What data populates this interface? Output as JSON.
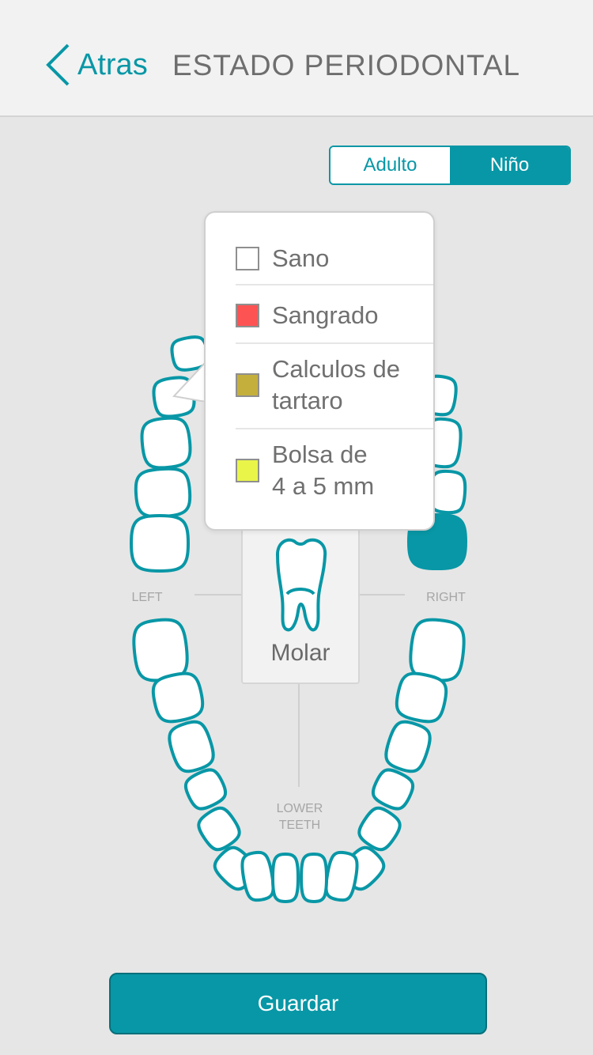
{
  "header": {
    "back_label": "Atras",
    "title": "ESTADO PERIODONTAL"
  },
  "segment": {
    "adult": "Adulto",
    "child": "Niño",
    "selected": "Niño"
  },
  "chart_labels": {
    "left": "LEFT",
    "right": "RIGHT",
    "lower": "LOWER TEETH"
  },
  "selected_tooth": {
    "label": "Molar"
  },
  "popup": {
    "options": [
      {
        "label": "Sano",
        "color": "#ffffff"
      },
      {
        "label": "Sangrado",
        "color": "#fd5353"
      },
      {
        "label": "Calculos de tartaro",
        "color": "#c4af3c"
      },
      {
        "label": "Bolsa de 4 a 5 mm",
        "color": "#e9f549"
      }
    ]
  },
  "footer": {
    "save_label": "Guardar"
  },
  "colors": {
    "accent": "#0897a6",
    "tooth_outline": "#0897a6",
    "tooth_fill": "#ffffff"
  }
}
